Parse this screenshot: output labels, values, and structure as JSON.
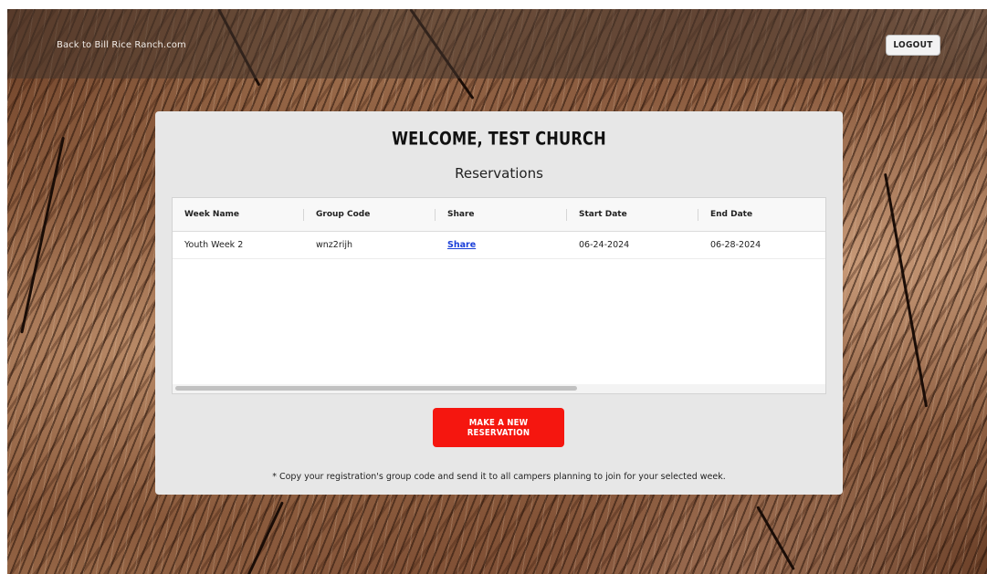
{
  "topbar": {
    "back_link": "Back to Bill Rice Ranch.com",
    "logout_label": "LOGOUT"
  },
  "card": {
    "welcome": "WELCOME, TEST CHURCH",
    "subtitle": "Reservations"
  },
  "table": {
    "columns": [
      "Week Name",
      "Group Code",
      "Share",
      "Start Date",
      "End Date"
    ],
    "rows": [
      {
        "week_name": "Youth Week 2",
        "group_code": "wnz2rijh",
        "share": "Share",
        "start_date": "06-24-2024",
        "end_date": "06-28-2024"
      }
    ]
  },
  "new_reservation_label": "MAKE A NEW RESERVATION",
  "note": "* Copy your registration's group code and send it to all campers planning to join for your selected week.",
  "colors": {
    "accent": "#f5160f",
    "link": "#1a3fd9",
    "card_bg": "#e7e7e7"
  }
}
